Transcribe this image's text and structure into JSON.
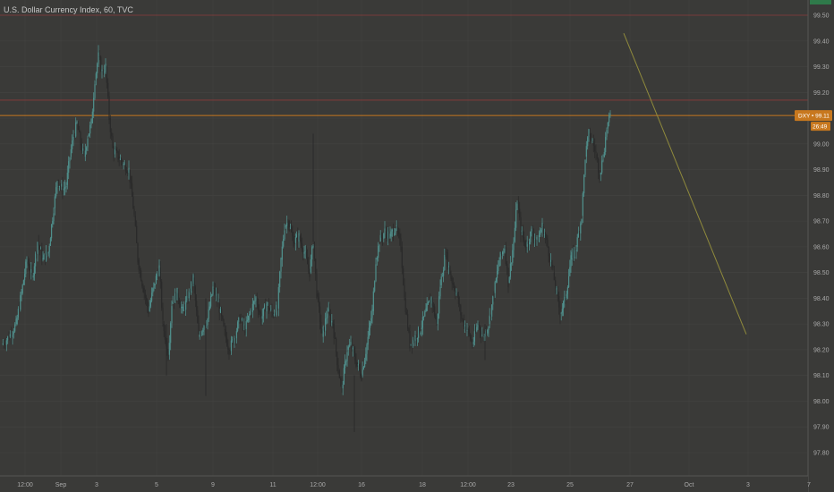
{
  "chart_data": {
    "type": "candlestick",
    "title": "U.S. Dollar Currency Index, 60, TVC",
    "symbol": "DXY",
    "last_price": 99.11,
    "countdown": "26:49",
    "y_range": [
      97.6,
      99.6
    ],
    "y_axis_ticks": [
      "99.50",
      "99.40",
      "99.30",
      "99.20",
      "99.10",
      "99.00",
      "98.90",
      "98.80",
      "98.70",
      "98.60",
      "98.50",
      "98.40",
      "98.30",
      "98.20",
      "98.10",
      "98.00",
      "97.90",
      "97.80"
    ],
    "x_axis_ticks": [
      "12:00",
      "Sep",
      "3",
      "5",
      "9",
      "11",
      "12:00",
      "16",
      "18",
      "12:00",
      "23",
      "25",
      "27",
      "Oct",
      "3",
      "7"
    ],
    "horizontal_lines": [
      {
        "value": 99.5,
        "color": "#8a3a3a"
      },
      {
        "value": 99.17,
        "color": "#8a3a3a"
      },
      {
        "value": 99.11,
        "color": "#c8781e"
      }
    ],
    "trend_line": {
      "from": [
        "Sep 26",
        99.43
      ],
      "to": [
        "Oct 3",
        98.26
      ],
      "color": "#8f8a3c"
    },
    "price_path": [
      [
        0,
        98.22
      ],
      [
        8,
        98.25
      ],
      [
        16,
        98.3
      ],
      [
        22,
        98.42
      ],
      [
        28,
        98.55
      ],
      [
        34,
        98.48
      ],
      [
        40,
        98.62
      ],
      [
        46,
        98.55
      ],
      [
        52,
        98.58
      ],
      [
        58,
        98.75
      ],
      [
        62,
        98.86
      ],
      [
        68,
        98.82
      ],
      [
        72,
        98.84
      ],
      [
        76,
        98.95
      ],
      [
        80,
        99.03
      ],
      [
        84,
        99.08
      ],
      [
        88,
        99.0
      ],
      [
        92,
        98.95
      ],
      [
        96,
        99.03
      ],
      [
        100,
        99.08
      ],
      [
        104,
        99.25
      ],
      [
        108,
        99.34
      ],
      [
        112,
        99.28
      ],
      [
        116,
        99.3
      ],
      [
        120,
        99.1
      ],
      [
        124,
        98.98
      ],
      [
        130,
        98.95
      ],
      [
        136,
        98.92
      ],
      [
        142,
        98.9
      ],
      [
        148,
        98.72
      ],
      [
        152,
        98.55
      ],
      [
        158,
        98.44
      ],
      [
        164,
        98.35
      ],
      [
        170,
        98.45
      ],
      [
        176,
        98.52
      ],
      [
        180,
        98.3
      ],
      [
        186,
        98.18
      ],
      [
        190,
        98.38
      ],
      [
        196,
        98.42
      ],
      [
        202,
        98.35
      ],
      [
        208,
        98.4
      ],
      [
        214,
        98.48
      ],
      [
        220,
        98.25
      ],
      [
        226,
        98.3
      ],
      [
        230,
        98.32
      ],
      [
        236,
        98.44
      ],
      [
        242,
        98.38
      ],
      [
        248,
        98.28
      ],
      [
        254,
        98.2
      ],
      [
        260,
        98.25
      ],
      [
        266,
        98.32
      ],
      [
        272,
        98.28
      ],
      [
        278,
        98.35
      ],
      [
        284,
        98.4
      ],
      [
        290,
        98.32
      ],
      [
        296,
        98.38
      ],
      [
        302,
        98.34
      ],
      [
        308,
        98.36
      ],
      [
        312,
        98.55
      ],
      [
        316,
        98.68
      ],
      [
        320,
        98.7
      ],
      [
        326,
        98.62
      ],
      [
        332,
        98.64
      ],
      [
        338,
        98.58
      ],
      [
        344,
        98.5
      ],
      [
        348,
        98.62
      ],
      [
        352,
        98.42
      ],
      [
        358,
        98.25
      ],
      [
        364,
        98.35
      ],
      [
        370,
        98.3
      ],
      [
        376,
        98.12
      ],
      [
        380,
        98.05
      ],
      [
        386,
        98.2
      ],
      [
        390,
        98.22
      ],
      [
        396,
        98.15
      ],
      [
        402,
        98.1
      ],
      [
        408,
        98.22
      ],
      [
        414,
        98.35
      ],
      [
        418,
        98.55
      ],
      [
        422,
        98.62
      ],
      [
        428,
        98.66
      ],
      [
        434,
        98.64
      ],
      [
        440,
        98.68
      ],
      [
        446,
        98.6
      ],
      [
        450,
        98.4
      ],
      [
        456,
        98.22
      ],
      [
        462,
        98.25
      ],
      [
        468,
        98.28
      ],
      [
        474,
        98.35
      ],
      [
        480,
        98.4
      ],
      [
        486,
        98.3
      ],
      [
        490,
        98.45
      ],
      [
        496,
        98.58
      ],
      [
        502,
        98.48
      ],
      [
        508,
        98.42
      ],
      [
        514,
        98.32
      ],
      [
        520,
        98.28
      ],
      [
        526,
        98.22
      ],
      [
        532,
        98.3
      ],
      [
        538,
        98.25
      ],
      [
        544,
        98.3
      ],
      [
        550,
        98.42
      ],
      [
        556,
        98.55
      ],
      [
        562,
        98.6
      ],
      [
        566,
        98.46
      ],
      [
        572,
        98.62
      ],
      [
        576,
        98.78
      ],
      [
        580,
        98.66
      ],
      [
        586,
        98.6
      ],
      [
        592,
        98.66
      ],
      [
        598,
        98.62
      ],
      [
        604,
        98.68
      ],
      [
        610,
        98.6
      ],
      [
        616,
        98.5
      ],
      [
        620,
        98.42
      ],
      [
        624,
        98.34
      ],
      [
        630,
        98.4
      ],
      [
        636,
        98.55
      ],
      [
        642,
        98.6
      ],
      [
        648,
        98.72
      ],
      [
        652,
        98.95
      ],
      [
        656,
        99.04
      ],
      [
        660,
        99.01
      ],
      [
        664,
        98.96
      ],
      [
        668,
        98.88
      ],
      [
        672,
        98.95
      ],
      [
        676,
        99.06
      ],
      [
        680,
        99.11
      ]
    ]
  }
}
